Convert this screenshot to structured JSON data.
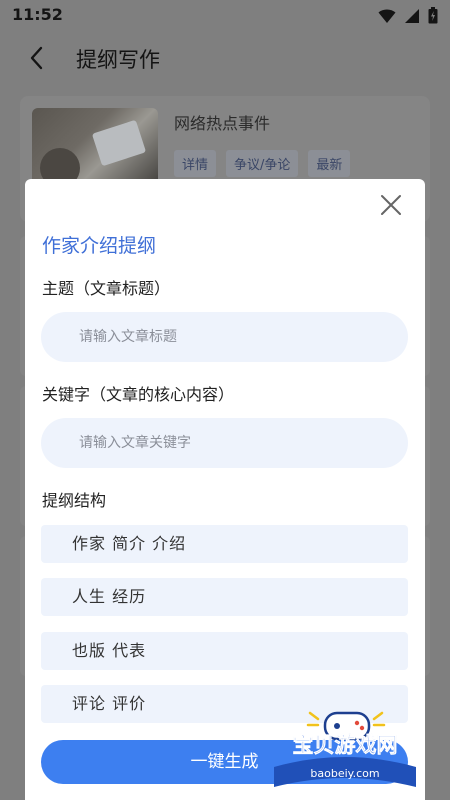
{
  "status_bar": {
    "time": "11:52",
    "icons": [
      "wifi-icon",
      "signal-icon",
      "battery-icon"
    ]
  },
  "header": {
    "back_icon": "back-arrow-icon",
    "title": "提纲写作"
  },
  "background_card": {
    "title": "网络热点事件",
    "tags": [
      "详情",
      "争议/争论",
      "最新"
    ]
  },
  "modal": {
    "close_icon": "close-icon",
    "title": "作家介绍提纲",
    "subject_label": "主题（文章标题）",
    "subject_placeholder": "请输入文章标题",
    "subject_value": "",
    "keywords_label": "关键字（文章的核心内容）",
    "keywords_placeholder": "请输入文章关键字",
    "keywords_value": "",
    "outline_label": "提纲结构",
    "outline_items": [
      "作家  简介  介绍",
      "人生  经历",
      "也版  代表",
      "评论  评价"
    ],
    "generate_button": "一键生成"
  },
  "watermark": {
    "text": "宝贝游戏网",
    "url": "baobeiy.com"
  },
  "colors": {
    "accent": "#3d7ff0",
    "title_blue": "#3f6fd7",
    "pill_bg": "#eef3fc",
    "overlay": "#7f7f7f"
  }
}
